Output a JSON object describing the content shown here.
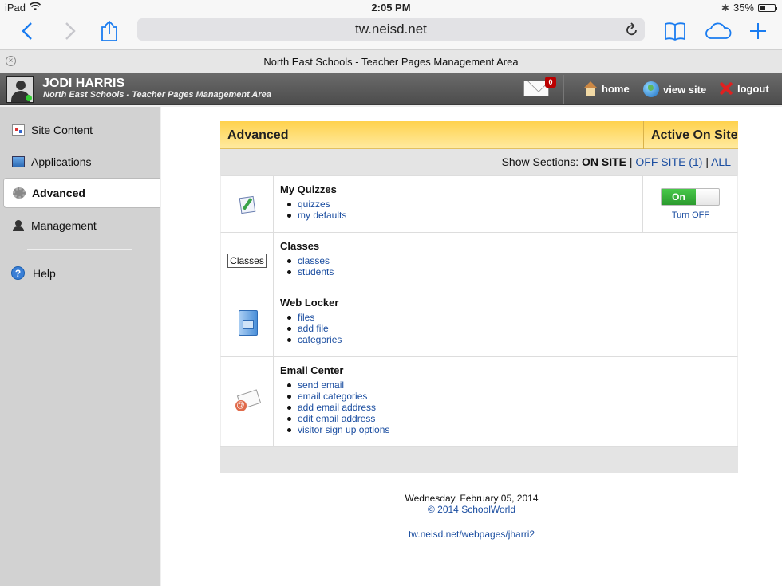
{
  "status": {
    "device": "iPad",
    "time": "2:05 PM",
    "battery": "35%"
  },
  "browser": {
    "url": "tw.neisd.net",
    "tab_title": "North East Schools - Teacher Pages Management Area",
    "icons": [
      "back-icon",
      "forward-icon",
      "share-icon",
      "reload-icon",
      "bookmarks-icon",
      "cloud-tabs-icon",
      "new-tab-icon"
    ]
  },
  "header": {
    "user_name": "JODI HARRIS",
    "subtitle": "North East Schools - Teacher Pages Management Area",
    "mail_count": "0",
    "links": {
      "home": "home",
      "view_site": "view site",
      "logout": "logout"
    }
  },
  "sidebar": {
    "items": [
      {
        "label": "Site Content",
        "icon": "site-content-icon"
      },
      {
        "label": "Applications",
        "icon": "applications-icon"
      },
      {
        "label": "Advanced",
        "icon": "gear-icon",
        "active": true
      },
      {
        "label": "Management",
        "icon": "user-icon"
      }
    ],
    "help": "Help"
  },
  "panel": {
    "title": "Advanced",
    "active_col": "Active On Site",
    "show_sections": {
      "label": "Show Sections:",
      "on_site": "ON SITE",
      "sep": "|",
      "off_site": "OFF SITE (1)",
      "all": "ALL"
    },
    "sections": [
      {
        "title": "My Quizzes",
        "links": [
          "quizzes",
          "my defaults"
        ],
        "toggle": "On",
        "toggle_action": "Turn OFF"
      },
      {
        "title": "Classes",
        "icon_text": "Classes",
        "links": [
          "classes",
          "students"
        ]
      },
      {
        "title": "Web Locker",
        "links": [
          "files",
          "add file",
          "categories"
        ]
      },
      {
        "title": "Email Center",
        "links": [
          "send email",
          "email categories",
          "add email address",
          "edit email address",
          "visitor sign up options"
        ]
      }
    ]
  },
  "footer": {
    "date": "Wednesday, February 05, 2014",
    "copyright": "© 2014 SchoolWorld",
    "url": "tw.neisd.net/webpages/jharri2"
  },
  "colors": {
    "accent_yellow": "#ffd24d",
    "link_blue": "#1a4da0",
    "toggle_green": "#2b9a2e",
    "header_gray": "#5a5a5a"
  }
}
